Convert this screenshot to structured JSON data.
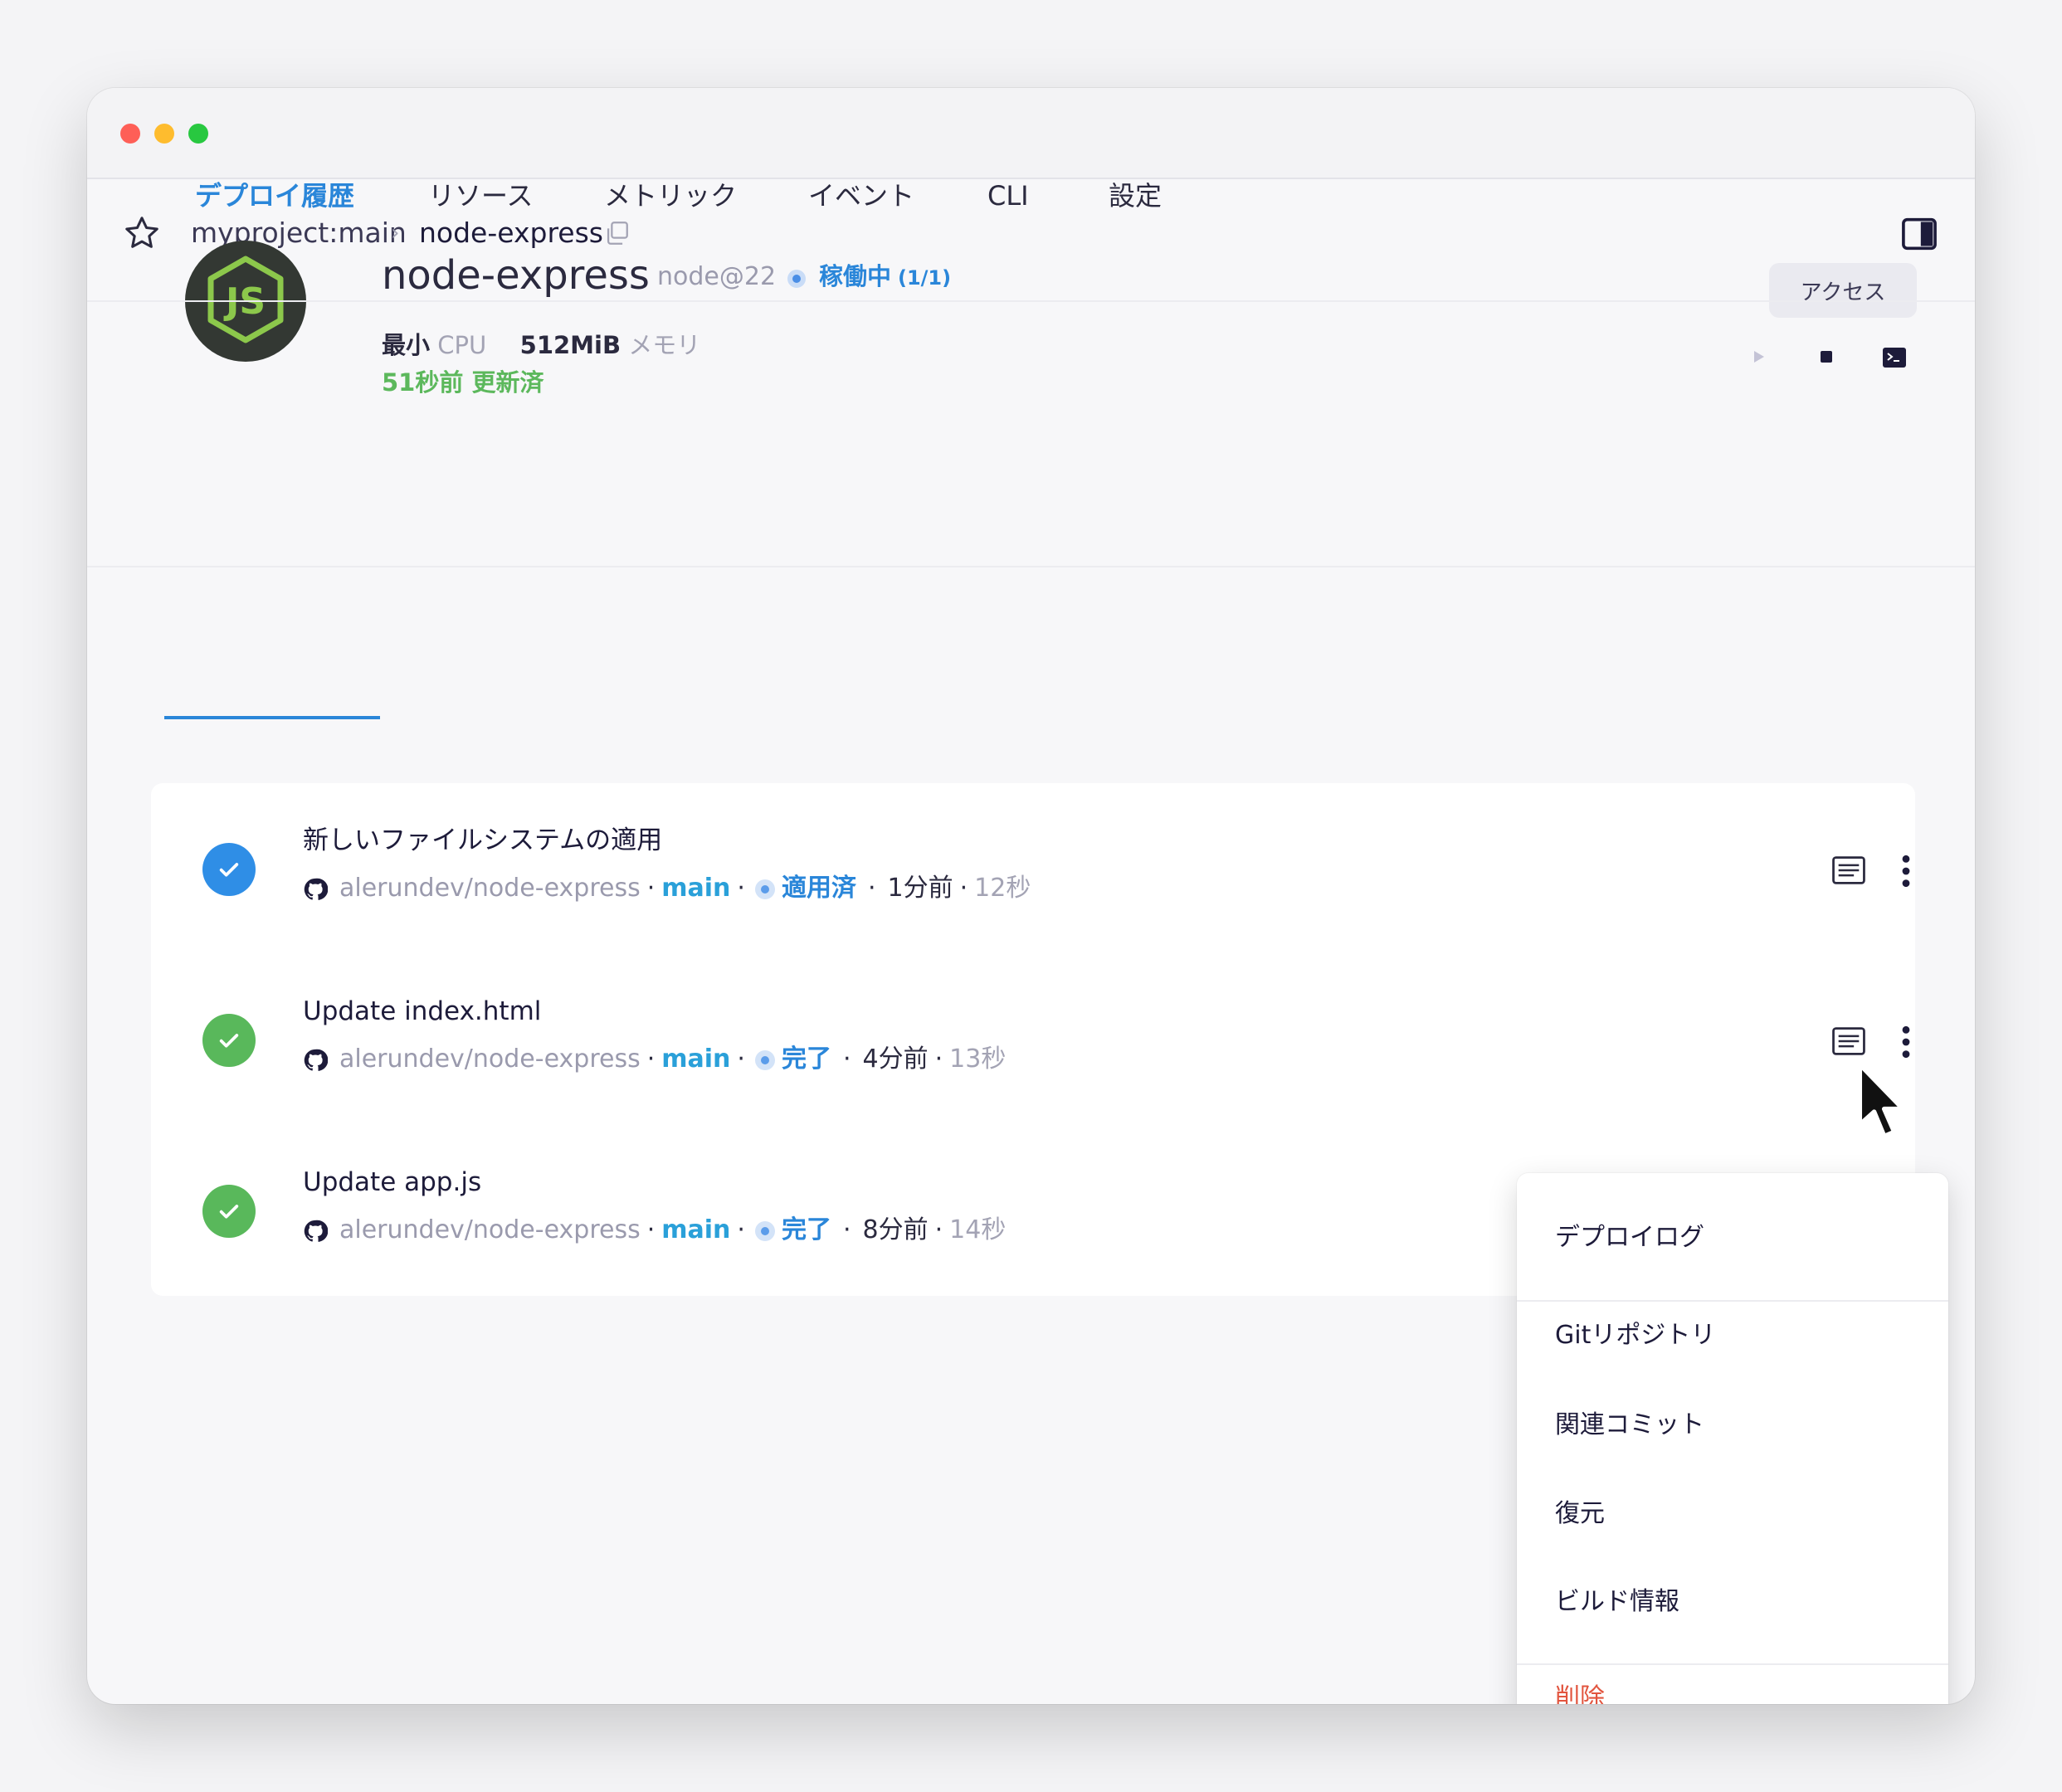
{
  "breadcrumb": {
    "project": "myproject:main",
    "separator": "›",
    "service": "node-express"
  },
  "service": {
    "name": "node-express",
    "runtime": "node@22",
    "status": "稼働中",
    "replicas": "(1/1)",
    "cpu_value": "最小",
    "cpu_unit": "CPU",
    "memory_value": "512MiB",
    "memory_unit": "メモリ",
    "updated": "51秒前 更新済",
    "access_label": "アクセス",
    "logo_icon": "nodejs-logo-icon"
  },
  "tabs": [
    {
      "label": "デプロイ履歴",
      "active": true
    },
    {
      "label": "リソース",
      "active": false
    },
    {
      "label": "メトリック",
      "active": false
    },
    {
      "label": "イベント",
      "active": false
    },
    {
      "label": "CLI",
      "active": false
    },
    {
      "label": "設定",
      "active": false
    }
  ],
  "deployments": [
    {
      "title": "新しいファイルシステムの適用",
      "repo": "alerundev/node-express",
      "branch": "main",
      "state": "適用済",
      "ago": "1分前",
      "duration": "12秒",
      "status_color": "#2f8ee6"
    },
    {
      "title": "Update index.html",
      "repo": "alerundev/node-express",
      "branch": "main",
      "state": "完了",
      "ago": "4分前",
      "duration": "13秒",
      "status_color": "#59b85b"
    },
    {
      "title": "Update app.js",
      "repo": "alerundev/node-express",
      "branch": "main",
      "state": "完了",
      "ago": "8分前",
      "duration": "14秒",
      "status_color": "#59b85b"
    }
  ],
  "meta_sep": "·",
  "context_menu": {
    "items": [
      "デプロイログ",
      "Gitリポジトリ",
      "関連コミット",
      "復元",
      "ビルド情報"
    ],
    "danger_item": "削除"
  },
  "colors": {
    "accent": "#2a86d9",
    "success": "#59b85b",
    "danger": "#e2553f"
  }
}
